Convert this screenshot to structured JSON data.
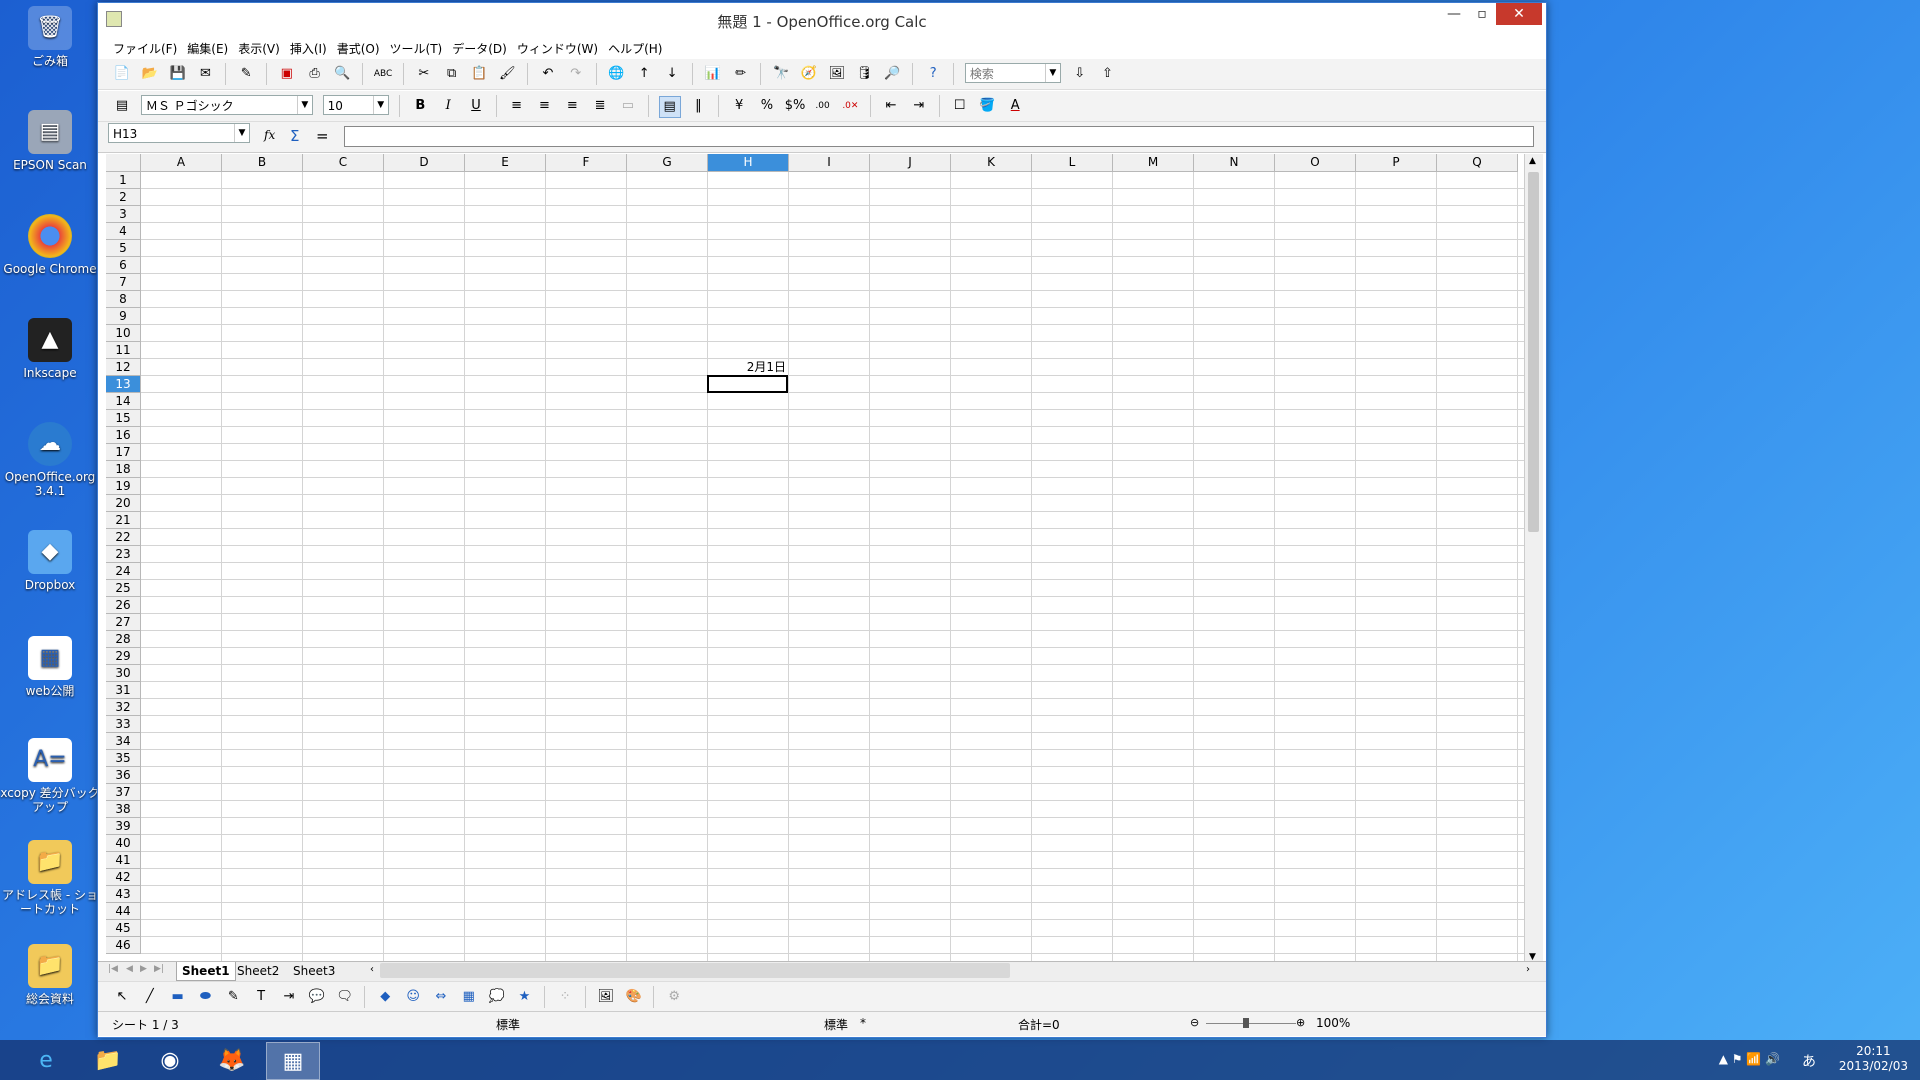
{
  "desktop": {
    "icons": [
      {
        "label": "ごみ箱",
        "icon": "recycle-bin-icon"
      },
      {
        "label": "EPSON Scan",
        "icon": "scanner-icon"
      },
      {
        "label": "Google Chrome",
        "icon": "chrome-icon"
      },
      {
        "label": "Inkscape",
        "icon": "inkscape-icon"
      },
      {
        "label": "OpenOffice.org 3.4.1",
        "icon": "openoffice-icon"
      },
      {
        "label": "Dropbox",
        "icon": "dropbox-icon"
      },
      {
        "label": "web公開",
        "icon": "document-icon"
      },
      {
        "label": "xcopy 差分バックアップ",
        "icon": "batch-file-icon"
      },
      {
        "label": "アドレス帳 - ショートカット",
        "icon": "folder-shortcut-icon"
      },
      {
        "label": "総会資料",
        "icon": "folder-icon"
      }
    ]
  },
  "window": {
    "title": "無題 1 - OpenOffice.org Calc",
    "menu": [
      "ファイル(F)",
      "編集(E)",
      "表示(V)",
      "挿入(I)",
      "書式(O)",
      "ツール(T)",
      "データ(D)",
      "ウィンドウ(W)",
      "ヘルプ(H)"
    ]
  },
  "toolbar": {
    "search_placeholder": "検索",
    "font_name": "ＭＳ Ｐゴシック",
    "font_size": "10",
    "bold": "B",
    "italic": "I",
    "underline": "U"
  },
  "formula": {
    "cell_ref": "H13",
    "fx": "fx",
    "sum": "Σ",
    "equals": "=",
    "value": ""
  },
  "sheet": {
    "columns": [
      "A",
      "B",
      "C",
      "D",
      "E",
      "F",
      "G",
      "H",
      "I",
      "J",
      "K",
      "L",
      "M",
      "N",
      "O",
      "P",
      "Q"
    ],
    "selected_column": "H",
    "selected_row": 13,
    "row_count": 46,
    "cell_h12": "2月1日",
    "tabs": [
      "Sheet1",
      "Sheet2",
      "Sheet3"
    ]
  },
  "status": {
    "sheet_pos": "シート 1 / 3",
    "style": "標準",
    "mode": "標準",
    "modified": "*",
    "sum": "合計=0",
    "zoom": "100%"
  },
  "taskbar": {
    "time": "20:11",
    "date": "2013/02/03",
    "ime": "あ"
  }
}
